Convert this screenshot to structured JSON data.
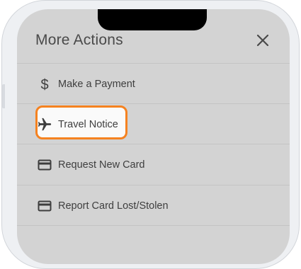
{
  "header": {
    "title": "More Actions"
  },
  "actions": [
    {
      "label": "Make a Payment",
      "icon": "dollar-icon"
    },
    {
      "label": "Travel Notice",
      "icon": "airplane-icon"
    },
    {
      "label": "Request New Card",
      "icon": "credit-card-icon"
    },
    {
      "label": "Report Card Lost/Stolen",
      "icon": "credit-card-icon"
    }
  ],
  "colors": {
    "highlight_border": "#f58220",
    "screen_background": "#d3d3d3",
    "text": "#3e3e3e"
  }
}
